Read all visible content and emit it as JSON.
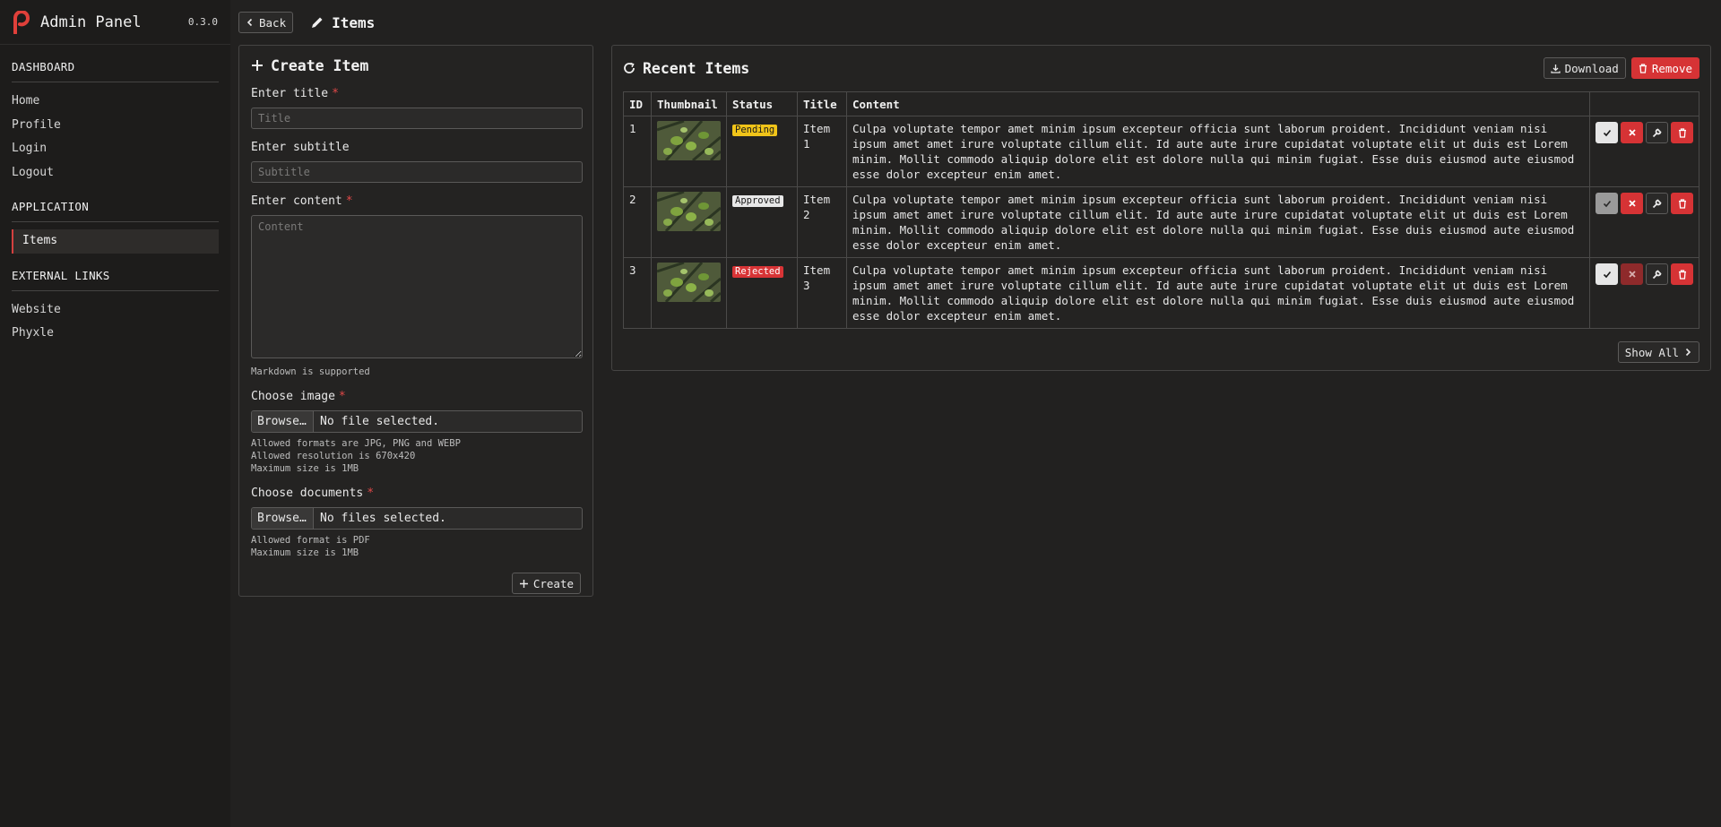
{
  "app": {
    "title": "Admin Panel",
    "version": "0.3.0",
    "accent": "#d63335"
  },
  "sidebar": {
    "sections": [
      {
        "heading": "DASHBOARD",
        "items": [
          "Home",
          "Profile",
          "Login",
          "Logout"
        ]
      },
      {
        "heading": "APPLICATION",
        "items": [
          "Items"
        ]
      },
      {
        "heading": "EXTERNAL LINKS",
        "items": [
          "Website",
          "Phyxle"
        ]
      }
    ],
    "active_item": "Items"
  },
  "header": {
    "back_label": "Back",
    "page_title": "Items",
    "page_icon": "pencil-icon"
  },
  "create_form": {
    "title": "Create Item",
    "title_label": "Enter title",
    "title_placeholder": "Title",
    "subtitle_label": "Enter subtitle",
    "subtitle_placeholder": "Subtitle",
    "content_label": "Enter content",
    "content_placeholder": "Content",
    "content_hint": "Markdown is supported",
    "image_label": "Choose image",
    "image_button": "Browse…",
    "image_status": "No file selected.",
    "image_hints": [
      "Allowed formats are JPG, PNG and WEBP",
      "Allowed resolution is 670x420",
      "Maximum size is 1MB"
    ],
    "docs_label": "Choose documents",
    "docs_button": "Browse…",
    "docs_status": "No files selected.",
    "docs_hints": [
      "Allowed format is PDF",
      "Maximum size is 1MB"
    ],
    "required_mark": "*",
    "submit_label": "Create"
  },
  "recent": {
    "title": "Recent Items",
    "download_label": "Download",
    "remove_label": "Remove",
    "columns": [
      "ID",
      "Thumbnail",
      "Status",
      "Title",
      "Content"
    ],
    "rows": [
      {
        "id": "1",
        "status": "Pending",
        "status_kind": "pending",
        "title": "Item 1",
        "content": "Culpa voluptate tempor amet minim ipsum excepteur officia sunt laborum proident. Incididunt veniam nisi ipsum amet amet irure voluptate cillum elit. Id aute aute irure cupidatat voluptate elit ut duis est Lorem minim. Mollit commodo aliquip dolore elit est dolore nulla qui minim fugiat. Esse duis eiusmod aute eiusmod esse dolor excepteur enim amet."
      },
      {
        "id": "2",
        "status": "Approved",
        "status_kind": "approved",
        "title": "Item 2",
        "content": "Culpa voluptate tempor amet minim ipsum excepteur officia sunt laborum proident. Incididunt veniam nisi ipsum amet amet irure voluptate cillum elit. Id aute aute irure cupidatat voluptate elit ut duis est Lorem minim. Mollit commodo aliquip dolore elit est dolore nulla qui minim fugiat. Esse duis eiusmod aute eiusmod esse dolor excepteur enim amet."
      },
      {
        "id": "3",
        "status": "Rejected",
        "status_kind": "rejected",
        "title": "Item 3",
        "content": "Culpa voluptate tempor amet minim ipsum excepteur officia sunt laborum proident. Incididunt veniam nisi ipsum amet amet irure voluptate cillum elit. Id aute aute irure cupidatat voluptate elit ut duis est Lorem minim. Mollit commodo aliquip dolore elit est dolore nulla qui minim fugiat. Esse duis eiusmod aute eiusmod esse dolor excepteur enim amet."
      }
    ],
    "show_all_label": "Show All"
  }
}
